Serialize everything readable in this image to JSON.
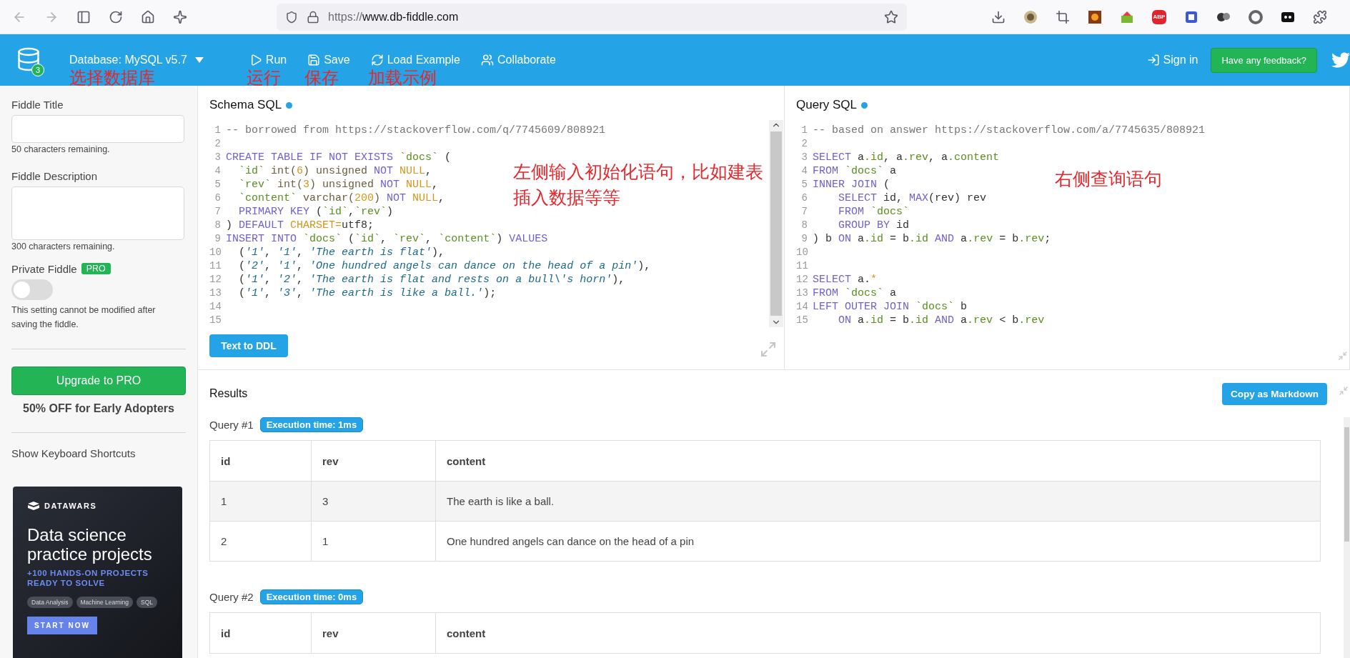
{
  "browser": {
    "url_scheme": "https://",
    "url_host": "www.db-fiddle.com",
    "extension_badge": "ABP"
  },
  "header": {
    "logo_badge": "3",
    "database": "Database: MySQL v5.7",
    "database_annotation": "选择数据库",
    "actions": [
      {
        "kind": "run",
        "label": "Run",
        "annotation": "运行"
      },
      {
        "kind": "save",
        "label": "Save",
        "annotation": "保存"
      },
      {
        "kind": "load",
        "label": "Load Example",
        "annotation": "加载示例"
      },
      {
        "kind": "collaborate",
        "label": "Collaborate"
      }
    ],
    "sign_in": "Sign in",
    "feedback": "Have any feedback?"
  },
  "sidebar": {
    "title_label": "Fiddle Title",
    "title_hint": "50 characters remaining.",
    "description_label": "Fiddle Description",
    "description_hint": "300 characters remaining.",
    "private_label": "Private Fiddle",
    "pro_badge": "PRO",
    "private_on": false,
    "private_note": "This setting cannot be modified after saving the fiddle.",
    "upgrade_button": "Upgrade to PRO",
    "offer": "50% OFF for Early Adopters",
    "shortcuts_link": "Show Keyboard Shortcuts",
    "ad": {
      "brand": "DATAWARS",
      "headline": "Data science practice projects",
      "subline": "+100 HANDS-ON PROJECTS READY TO SOLVE",
      "tags": [
        "Data Analysis",
        "Machine Learning",
        "SQL"
      ],
      "cta": "START NOW"
    }
  },
  "schema": {
    "title": "Schema SQL",
    "button": "Text to DDL",
    "annotation": [
      "左侧输入初始化语句，比如建表",
      "插入数据等等"
    ],
    "lines": [
      {
        "no": "1",
        "tokens": [
          {
            "kind": "cm",
            "text": "-- borrowed from https://stackoverflow.com/q/7745609/808921"
          }
        ]
      },
      {
        "no": "2"
      },
      {
        "no": "3",
        "tokens": [
          {
            "kind": "kw",
            "text": "CREATE TABLE IF NOT EXISTS "
          },
          {
            "kind": "id",
            "text": "`docs`"
          },
          {
            "kind": "pl",
            "text": " ("
          }
        ]
      },
      {
        "no": "4",
        "tokens": [
          {
            "kind": "id",
            "text": "  `id`"
          },
          {
            "kind": "ty",
            "text": " int("
          },
          {
            "kind": "nu",
            "text": "6"
          },
          {
            "kind": "ty",
            "text": ") unsigned "
          },
          {
            "kind": "kw",
            "text": "NOT "
          },
          {
            "kind": "nu",
            "text": "NULL"
          },
          {
            "kind": "pl",
            "text": ","
          }
        ]
      },
      {
        "no": "5",
        "tokens": [
          {
            "kind": "id",
            "text": "  `rev`"
          },
          {
            "kind": "ty",
            "text": " int("
          },
          {
            "kind": "nu",
            "text": "3"
          },
          {
            "kind": "ty",
            "text": ") unsigned "
          },
          {
            "kind": "kw",
            "text": "NOT "
          },
          {
            "kind": "nu",
            "text": "NULL"
          },
          {
            "kind": "pl",
            "text": ","
          }
        ]
      },
      {
        "no": "6",
        "tokens": [
          {
            "kind": "id",
            "text": "  `content`"
          },
          {
            "kind": "ty",
            "text": " varchar("
          },
          {
            "kind": "nu",
            "text": "200"
          },
          {
            "kind": "ty",
            "text": ") "
          },
          {
            "kind": "kw",
            "text": "NOT "
          },
          {
            "kind": "nu",
            "text": "NULL"
          },
          {
            "kind": "pl",
            "text": ","
          }
        ]
      },
      {
        "no": "7",
        "tokens": [
          {
            "kind": "kw",
            "text": "  PRIMARY KEY "
          },
          {
            "kind": "pl",
            "text": "("
          },
          {
            "kind": "id",
            "text": "`id`"
          },
          {
            "kind": "pl",
            "text": ","
          },
          {
            "kind": "id",
            "text": "`rev`"
          },
          {
            "kind": "pl",
            "text": ")"
          }
        ]
      },
      {
        "no": "8",
        "tokens": [
          {
            "kind": "pl",
            "text": ") "
          },
          {
            "kind": "kw",
            "text": "DEFAULT "
          },
          {
            "kind": "nu",
            "text": "CHARSET="
          },
          {
            "kind": "pl",
            "text": "utf8;"
          }
        ]
      },
      {
        "no": "9",
        "tokens": [
          {
            "kind": "kw",
            "text": "INSERT INTO "
          },
          {
            "kind": "id",
            "text": "`docs`"
          },
          {
            "kind": "pl",
            "text": " ("
          },
          {
            "kind": "id",
            "text": "`id`"
          },
          {
            "kind": "pl",
            "text": ", "
          },
          {
            "kind": "id",
            "text": "`rev`"
          },
          {
            "kind": "pl",
            "text": ", "
          },
          {
            "kind": "id",
            "text": "`content`"
          },
          {
            "kind": "pl",
            "text": ") "
          },
          {
            "kind": "kw",
            "text": "VALUES"
          }
        ]
      },
      {
        "no": "10",
        "tokens": [
          {
            "kind": "pl",
            "text": "  ("
          },
          {
            "kind": "st",
            "text": "'1'"
          },
          {
            "kind": "pl",
            "text": ", "
          },
          {
            "kind": "st",
            "text": "'1'"
          },
          {
            "kind": "pl",
            "text": ", "
          },
          {
            "kind": "st",
            "text": "'The earth is flat'"
          },
          {
            "kind": "pl",
            "text": "),"
          }
        ]
      },
      {
        "no": "11",
        "tokens": [
          {
            "kind": "pl",
            "text": "  ("
          },
          {
            "kind": "st",
            "text": "'2'"
          },
          {
            "kind": "pl",
            "text": ", "
          },
          {
            "kind": "st",
            "text": "'1'"
          },
          {
            "kind": "pl",
            "text": ", "
          },
          {
            "kind": "st",
            "text": "'One hundred angels can dance on the head of a pin'"
          },
          {
            "kind": "pl",
            "text": "),"
          }
        ]
      },
      {
        "no": "12",
        "tokens": [
          {
            "kind": "pl",
            "text": "  ("
          },
          {
            "kind": "st",
            "text": "'1'"
          },
          {
            "kind": "pl",
            "text": ", "
          },
          {
            "kind": "st",
            "text": "'2'"
          },
          {
            "kind": "pl",
            "text": ", "
          },
          {
            "kind": "st",
            "text": "'The earth is flat and rests on a bull\\'s horn'"
          },
          {
            "kind": "pl",
            "text": "),"
          }
        ]
      },
      {
        "no": "13",
        "tokens": [
          {
            "kind": "pl",
            "text": "  ("
          },
          {
            "kind": "st",
            "text": "'1'"
          },
          {
            "kind": "pl",
            "text": ", "
          },
          {
            "kind": "st",
            "text": "'3'"
          },
          {
            "kind": "pl",
            "text": ", "
          },
          {
            "kind": "st",
            "text": "'The earth is like a ball.'"
          },
          {
            "kind": "pl",
            "text": ");"
          }
        ]
      },
      {
        "no": "14"
      },
      {
        "no": "15"
      }
    ]
  },
  "query": {
    "title": "Query SQL",
    "annotation": [
      "右侧查询语句"
    ],
    "lines": [
      {
        "no": "1",
        "tokens": [
          {
            "kind": "cm",
            "text": "-- based on answer https://stackoverflow.com/a/7745635/808921"
          }
        ]
      },
      {
        "no": "2"
      },
      {
        "no": "3",
        "tokens": [
          {
            "kind": "kw",
            "text": "SELECT "
          },
          {
            "kind": "pl",
            "text": "a"
          },
          {
            "kind": "id",
            "text": ".id"
          },
          {
            "kind": "pl",
            "text": ", a"
          },
          {
            "kind": "id",
            "text": ".rev"
          },
          {
            "kind": "pl",
            "text": ", a"
          },
          {
            "kind": "id",
            "text": ".content"
          }
        ]
      },
      {
        "no": "4",
        "tokens": [
          {
            "kind": "kw",
            "text": "FROM "
          },
          {
            "kind": "id",
            "text": "`docs`"
          },
          {
            "kind": "pl",
            "text": " a"
          }
        ]
      },
      {
        "no": "5",
        "tokens": [
          {
            "kind": "kw",
            "text": "INNER JOIN "
          },
          {
            "kind": "pl",
            "text": "("
          }
        ]
      },
      {
        "no": "6",
        "tokens": [
          {
            "kind": "kw",
            "text": "    SELECT "
          },
          {
            "kind": "pl",
            "text": "id, "
          },
          {
            "kind": "kw",
            "text": "MAX"
          },
          {
            "kind": "pl",
            "text": "(rev) rev"
          }
        ]
      },
      {
        "no": "7",
        "tokens": [
          {
            "kind": "kw",
            "text": "    FROM "
          },
          {
            "kind": "id",
            "text": "`docs`"
          }
        ]
      },
      {
        "no": "8",
        "tokens": [
          {
            "kind": "kw",
            "text": "    GROUP BY "
          },
          {
            "kind": "pl",
            "text": "id"
          }
        ]
      },
      {
        "no": "9",
        "tokens": [
          {
            "kind": "pl",
            "text": ") b "
          },
          {
            "kind": "kw",
            "text": "ON "
          },
          {
            "kind": "pl",
            "text": "a"
          },
          {
            "kind": "id",
            "text": ".id"
          },
          {
            "kind": "pl",
            "text": " = b"
          },
          {
            "kind": "id",
            "text": ".id"
          },
          {
            "kind": "kw",
            "text": " AND "
          },
          {
            "kind": "pl",
            "text": "a"
          },
          {
            "kind": "id",
            "text": ".rev"
          },
          {
            "kind": "pl",
            "text": " = b"
          },
          {
            "kind": "id",
            "text": ".rev"
          },
          {
            "kind": "pl",
            "text": ";"
          }
        ]
      },
      {
        "no": "10"
      },
      {
        "no": "11"
      },
      {
        "no": "12",
        "tokens": [
          {
            "kind": "kw",
            "text": "SELECT "
          },
          {
            "kind": "pl",
            "text": "a."
          },
          {
            "kind": "nu",
            "text": "*"
          }
        ]
      },
      {
        "no": "13",
        "tokens": [
          {
            "kind": "kw",
            "text": "FROM "
          },
          {
            "kind": "id",
            "text": "`docs`"
          },
          {
            "kind": "pl",
            "text": " a"
          }
        ]
      },
      {
        "no": "14",
        "tokens": [
          {
            "kind": "kw",
            "text": "LEFT OUTER JOIN "
          },
          {
            "kind": "id",
            "text": "`docs`"
          },
          {
            "kind": "pl",
            "text": " b"
          }
        ]
      },
      {
        "no": "15",
        "tokens": [
          {
            "kind": "kw",
            "text": "    ON "
          },
          {
            "kind": "pl",
            "text": "a"
          },
          {
            "kind": "id",
            "text": ".id"
          },
          {
            "kind": "pl",
            "text": " = b"
          },
          {
            "kind": "id",
            "text": ".id"
          },
          {
            "kind": "kw",
            "text": " AND "
          },
          {
            "kind": "pl",
            "text": "a"
          },
          {
            "kind": "id",
            "text": ".rev"
          },
          {
            "kind": "pl",
            "text": " < b"
          },
          {
            "kind": "id",
            "text": ".rev"
          }
        ]
      }
    ]
  },
  "results": {
    "title": "Results",
    "copy_button": "Copy as Markdown",
    "queries": [
      {
        "label": "Query #1",
        "time": "Execution time: 1ms",
        "columns": [
          "id",
          "rev",
          "content"
        ],
        "rows": [
          [
            "1",
            "3",
            "The earth is like a ball."
          ],
          [
            "2",
            "1",
            "One hundred angels can dance on the head of a pin"
          ]
        ]
      },
      {
        "label": "Query #2",
        "time": "Execution time: 0ms",
        "columns": [
          "id",
          "rev",
          "content"
        ]
      }
    ]
  }
}
